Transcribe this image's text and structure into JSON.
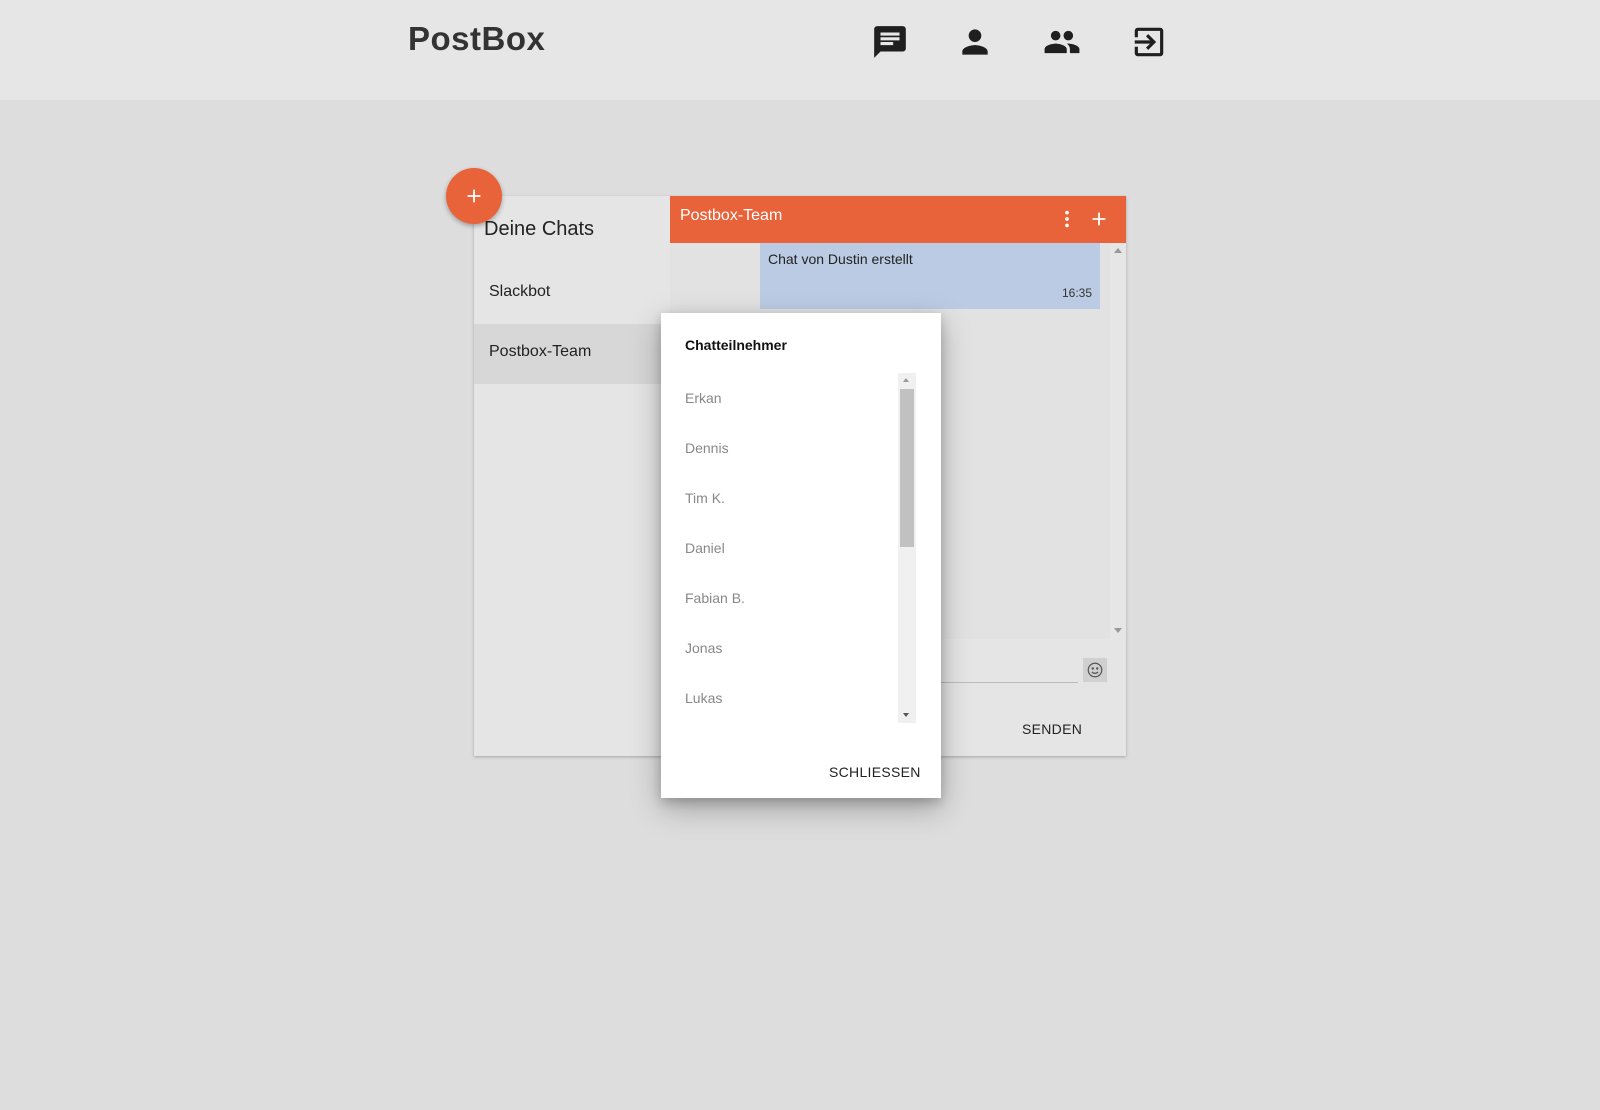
{
  "header": {
    "brand": "PostBox",
    "nav_icons": [
      "chat-icon",
      "person-icon",
      "group-icon",
      "logout-icon"
    ]
  },
  "sidebar": {
    "title": "Deine Chats",
    "chats": [
      {
        "label": "Slackbot",
        "active": false
      },
      {
        "label": "Postbox-Team",
        "active": true
      }
    ]
  },
  "chat": {
    "title": "Postbox-Team",
    "messages": [
      {
        "text": "Chat von Dustin erstellt",
        "time": "16:35"
      }
    ],
    "send_label": "SENDEN",
    "emoji_icon": "smiley-icon"
  },
  "fab_icon": "plus-icon",
  "dialog": {
    "title": "Chatteilnehmer",
    "participants": [
      "Erkan",
      "Dennis",
      "Tim K.",
      "Daniel",
      "Fabian B.",
      "Jonas",
      "Lukas"
    ],
    "close_label": "SCHLIESSEN"
  },
  "colors": {
    "accent": "#e8633a",
    "message_bubble": "#bccbe4",
    "background": "#dddddd",
    "topbar": "#e6e6e6"
  }
}
